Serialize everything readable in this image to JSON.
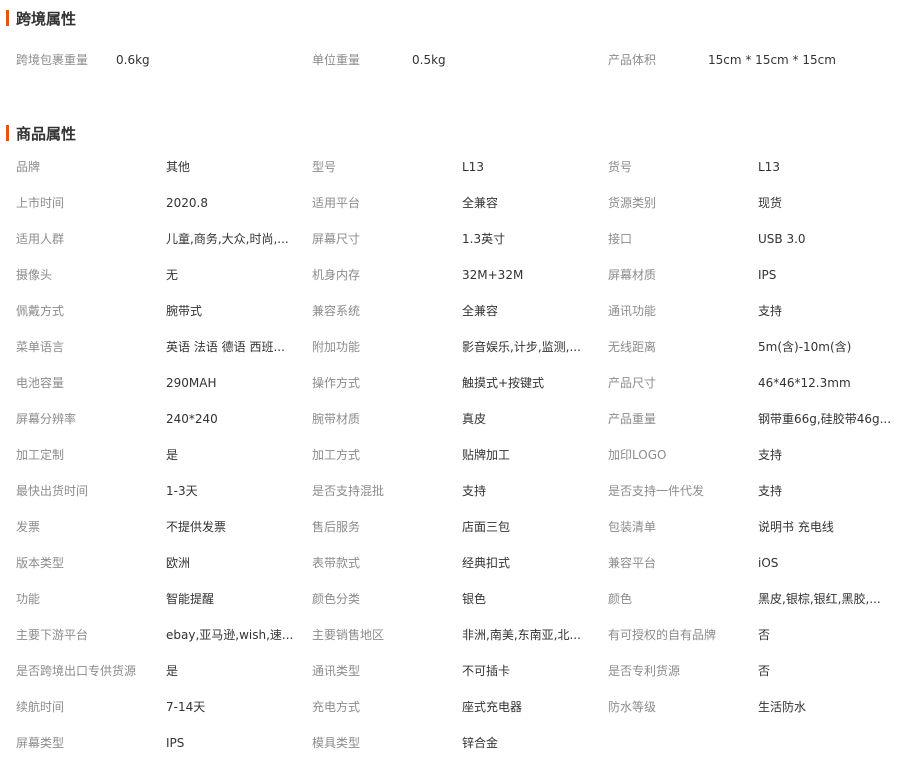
{
  "cross_border": {
    "title": "跨境属性",
    "rows": [
      [
        {
          "label": "跨境包裹重量",
          "value": "0.6kg"
        },
        {
          "label": "单位重量",
          "value": "0.5kg"
        },
        {
          "label": "产品体积",
          "value": "15cm * 15cm * 15cm"
        }
      ]
    ]
  },
  "product": {
    "title": "商品属性",
    "rows": [
      [
        {
          "label": "品牌",
          "value": "其他"
        },
        {
          "label": "型号",
          "value": "L13"
        },
        {
          "label": "货号",
          "value": "L13"
        }
      ],
      [
        {
          "label": "上市时间",
          "value": "2020.8"
        },
        {
          "label": "适用平台",
          "value": "全兼容"
        },
        {
          "label": "货源类别",
          "value": "现货"
        }
      ],
      [
        {
          "label": "适用人群",
          "value": "儿童,商务,大众,时尚,..."
        },
        {
          "label": "屏幕尺寸",
          "value": "1.3英寸"
        },
        {
          "label": "接口",
          "value": "USB 3.0"
        }
      ],
      [
        {
          "label": "摄像头",
          "value": "无"
        },
        {
          "label": "机身内存",
          "value": "32M+32M"
        },
        {
          "label": "屏幕材质",
          "value": "IPS"
        }
      ],
      [
        {
          "label": "佩戴方式",
          "value": "腕带式"
        },
        {
          "label": "兼容系统",
          "value": "全兼容"
        },
        {
          "label": "通讯功能",
          "value": "支持"
        }
      ],
      [
        {
          "label": "菜单语言",
          "value": "英语 法语 德语 西班..."
        },
        {
          "label": "附加功能",
          "value": "影音娱乐,计步,监测,..."
        },
        {
          "label": "无线距离",
          "value": "5m(含)-10m(含)"
        }
      ],
      [
        {
          "label": "电池容量",
          "value": "290MAH"
        },
        {
          "label": "操作方式",
          "value": "触摸式+按键式"
        },
        {
          "label": "产品尺寸",
          "value": "46*46*12.3mm"
        }
      ],
      [
        {
          "label": "屏幕分辨率",
          "value": "240*240"
        },
        {
          "label": "腕带材质",
          "value": "真皮"
        },
        {
          "label": "产品重量",
          "value": "钢带重66g,硅胶带46g..."
        }
      ],
      [
        {
          "label": "加工定制",
          "value": "是"
        },
        {
          "label": "加工方式",
          "value": "贴牌加工"
        },
        {
          "label": "加印LOGO",
          "value": "支持"
        }
      ],
      [
        {
          "label": "最快出货时间",
          "value": "1-3天"
        },
        {
          "label": "是否支持混批",
          "value": "支持"
        },
        {
          "label": "是否支持一件代发",
          "value": "支持"
        }
      ],
      [
        {
          "label": "发票",
          "value": "不提供发票"
        },
        {
          "label": "售后服务",
          "value": "店面三包"
        },
        {
          "label": "包装清单",
          "value": "说明书 充电线"
        }
      ],
      [
        {
          "label": "版本类型",
          "value": "欧洲"
        },
        {
          "label": "表带款式",
          "value": "经典扣式"
        },
        {
          "label": "兼容平台",
          "value": "iOS"
        }
      ],
      [
        {
          "label": "功能",
          "value": "智能提醒"
        },
        {
          "label": "颜色分类",
          "value": "银色"
        },
        {
          "label": "颜色",
          "value": "黑皮,银棕,银红,黑胶,..."
        }
      ],
      [
        {
          "label": "主要下游平台",
          "value": "ebay,亚马逊,wish,速..."
        },
        {
          "label": "主要销售地区",
          "value": "非洲,南美,东南亚,北..."
        },
        {
          "label": "有可授权的自有品牌",
          "value": "否"
        }
      ],
      [
        {
          "label": "是否跨境出口专供货源",
          "value": "是"
        },
        {
          "label": "通讯类型",
          "value": "不可插卡"
        },
        {
          "label": "是否专利货源",
          "value": "否"
        }
      ],
      [
        {
          "label": "续航时间",
          "value": "7-14天"
        },
        {
          "label": "充电方式",
          "value": "座式充电器"
        },
        {
          "label": "防水等级",
          "value": "生活防水"
        }
      ],
      [
        {
          "label": "屏幕类型",
          "value": "IPS"
        },
        {
          "label": "模具类型",
          "value": "锌合金"
        },
        {
          "label": "",
          "value": ""
        }
      ]
    ]
  }
}
